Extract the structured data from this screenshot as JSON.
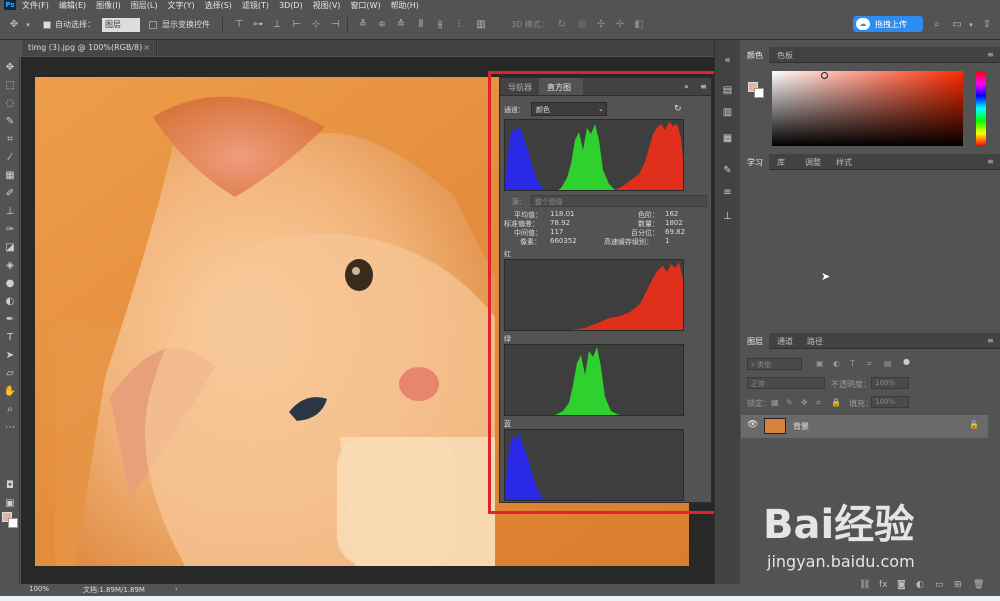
{
  "menu": [
    "文件(F)",
    "编辑(E)",
    "图像(I)",
    "图层(L)",
    "文字(Y)",
    "选择(S)",
    "滤镜(T)",
    "3D(D)",
    "视图(V)",
    "窗口(W)",
    "帮助(H)"
  ],
  "options": {
    "auto_select_label": "自动选择：",
    "auto_select_value": "图层",
    "show_transform_label": "显示变换控件",
    "mode_3d_label": "3D 模式：",
    "upload_label": "拖拽上传"
  },
  "document": {
    "tab_title": "timg (3).jpg @ 100%(RGB/8)",
    "zoom": "100%",
    "doc_size": "文档:1.89M/1.89M"
  },
  "histogram": {
    "tabs": [
      "导航器",
      "直方图"
    ],
    "active_tab": "直方图",
    "channel_label": "通道：",
    "channel_value": "颜色",
    "source_label": "源：",
    "source_value": "整个图像",
    "stats": {
      "mean_label": "平均值：",
      "mean": "118.01",
      "stddev_label": "标准偏差：",
      "stddev": "78.92",
      "median_label": "中间值：",
      "median": "117",
      "pixels_label": "像素：",
      "pixels": "660352",
      "level_label": "色阶：",
      "level": "162",
      "count_label": "数量：",
      "count": "1802",
      "percentile_label": "百分位：",
      "percentile": "69.82",
      "cache_label": "高速缓存级别：",
      "cache": "1"
    },
    "channel_red": "红",
    "channel_green": "绿",
    "channel_blue": "蓝",
    "colors": {
      "red": "#e0301c",
      "green": "#2fd12f",
      "blue": "#2a2ae6"
    }
  },
  "panels": {
    "color_tabs": [
      "颜色",
      "色板"
    ],
    "learn_tabs": [
      "学习",
      "库",
      "调整",
      "样式"
    ],
    "layers_tabs": [
      "图层",
      "通道",
      "路径"
    ],
    "layers_kind_placeholder": "类型",
    "blend_mode": "正常",
    "opacity_label": "不透明度：",
    "opacity_value": "100%",
    "lock_label": "锁定：",
    "fill_label": "填充：",
    "fill_value": "100%",
    "layer_name": "背景"
  },
  "watermark": {
    "brand": "Bai经验",
    "url": "jingyan.baidu.com"
  },
  "frame_color": "#e0232d"
}
